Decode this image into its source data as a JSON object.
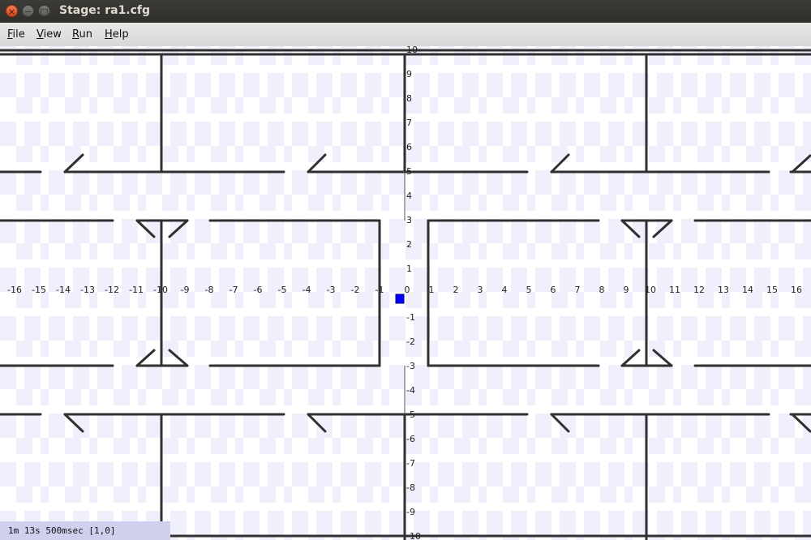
{
  "window": {
    "title": "Stage: ra1.cfg",
    "close_glyph": "×",
    "min_glyph": "−",
    "max_glyph": "□"
  },
  "menu": {
    "items": [
      {
        "mnemonic": "F",
        "rest": "ile"
      },
      {
        "mnemonic": "V",
        "rest": "iew"
      },
      {
        "mnemonic": "R",
        "rest": "un"
      },
      {
        "mnemonic": "H",
        "rest": "elp"
      }
    ]
  },
  "world": {
    "x_ticks": [
      -16,
      -15,
      -14,
      -13,
      -12,
      -11,
      -10,
      -9,
      -8,
      -7,
      -6,
      -5,
      -4,
      -3,
      -2,
      -1,
      0,
      1,
      2,
      3,
      4,
      5,
      6,
      7,
      8,
      9,
      10,
      11,
      12,
      13,
      14,
      15,
      16
    ],
    "y_ticks": [
      10,
      9,
      8,
      7,
      6,
      5,
      4,
      3,
      2,
      1,
      -1,
      -2,
      -3,
      -4,
      -5,
      -6,
      -7,
      -8,
      -9,
      -10
    ],
    "robot_color": "#0000ff",
    "wall_color": "#303030",
    "checker_color": "#f0f0fc"
  },
  "status": {
    "text": "1m 13s 500msec [1,0]"
  }
}
